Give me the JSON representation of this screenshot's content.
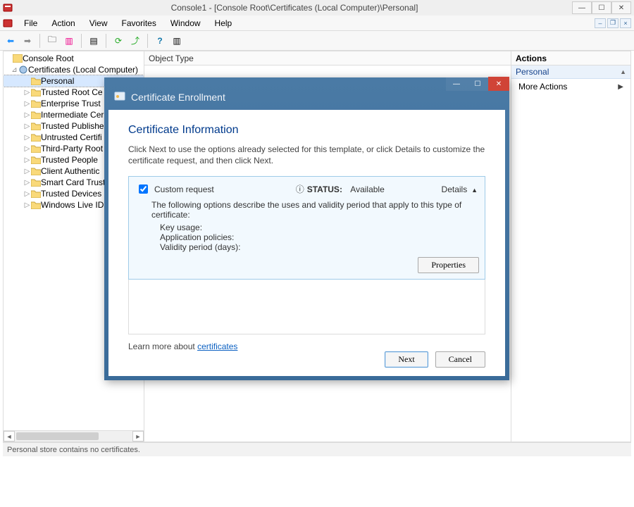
{
  "window": {
    "title": "Console1 - [Console Root\\Certificates (Local Computer)\\Personal]"
  },
  "menu": {
    "file": "File",
    "action": "Action",
    "view": "View",
    "favorites": "Favorites",
    "window": "Window",
    "help": "Help"
  },
  "tree": {
    "root": "Console Root",
    "certs": "Certificates (Local Computer)",
    "items": [
      "Personal",
      "Trusted Root Ce",
      "Enterprise Trust",
      "Intermediate Cer",
      "Trusted Publishe",
      "Untrusted Certifi",
      "Third-Party Root",
      "Trusted People",
      "Client Authentic",
      "Smart Card Trust",
      "Trusted Devices",
      "Windows Live ID"
    ]
  },
  "center": {
    "col0": "Object Type"
  },
  "actions": {
    "header": "Actions",
    "group": "Personal",
    "more": "More Actions"
  },
  "status": {
    "text": "Personal store contains no certificates."
  },
  "dialog": {
    "title": "Certificate Enrollment",
    "heading": "Certificate Information",
    "instructions": "Click Next to use the options already selected for this template, or click Details to customize the certificate request, and then click Next.",
    "request_label": "Custom request",
    "status_label": "STATUS:",
    "status_value": "Available",
    "details_label": "Details",
    "options_desc": "The following options describe the uses and validity period that apply to this type of certificate:",
    "key_usage": "Key usage:",
    "app_policies": "Application policies:",
    "validity": "Validity period (days):",
    "properties_btn": "Properties",
    "learn_prefix": "Learn more about ",
    "learn_link": "certificates",
    "next": "Next",
    "cancel": "Cancel"
  }
}
